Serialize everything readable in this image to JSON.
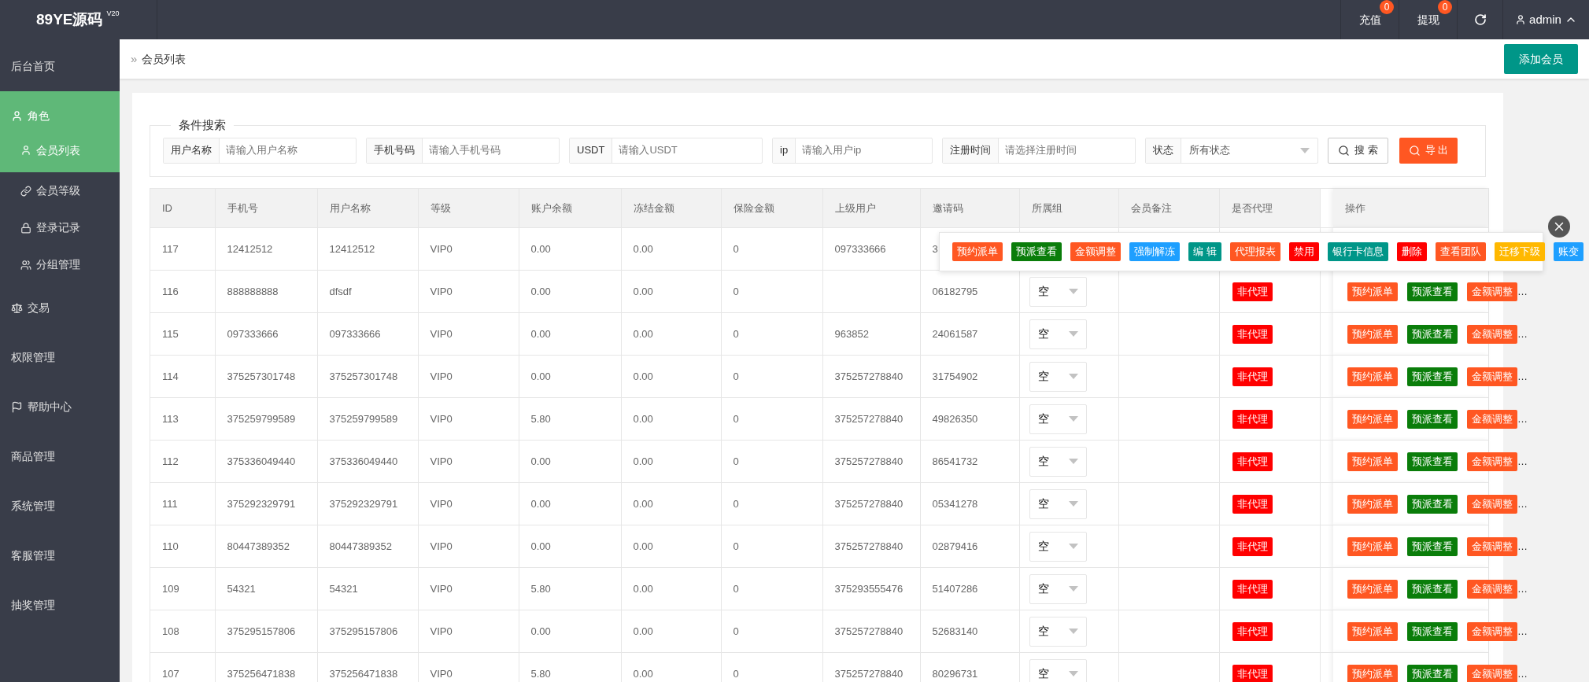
{
  "topbar": {
    "logo": "89YE源码",
    "version": "V20",
    "nav": [
      {
        "label": "充值",
        "badge": "0"
      },
      {
        "label": "提现",
        "badge": "0"
      }
    ],
    "user": "admin"
  },
  "sidebar": {
    "items": [
      {
        "label": "后台首页",
        "selected": false
      },
      {
        "label": "角色",
        "selected": true,
        "expanded": true,
        "children": [
          {
            "label": "会员列表",
            "selected": true
          },
          {
            "label": "会员等级",
            "selected": false
          },
          {
            "label": "登录记录",
            "selected": false
          },
          {
            "label": "分组管理",
            "selected": false
          }
        ]
      },
      {
        "label": "交易",
        "selected": false
      },
      {
        "label": "权限管理",
        "selected": false
      },
      {
        "label": "帮助中心",
        "selected": false
      },
      {
        "label": "商品管理",
        "selected": false
      },
      {
        "label": "系统管理",
        "selected": false
      },
      {
        "label": "客服管理",
        "selected": false
      },
      {
        "label": "抽奖管理",
        "selected": false
      }
    ]
  },
  "breadcrumb": {
    "separator": "»",
    "current": "会员列表"
  },
  "add_button": "添加会员",
  "search": {
    "legend": "条件搜索",
    "fields": [
      {
        "kind": "input",
        "label": "用户名称",
        "placeholder": "请输入用户名称"
      },
      {
        "kind": "input",
        "label": "手机号码",
        "placeholder": "请输入手机号码"
      },
      {
        "kind": "input",
        "label": "USDT",
        "placeholder": "请输入USDT"
      },
      {
        "kind": "input",
        "label": "ip",
        "placeholder": "请输入用户ip"
      },
      {
        "kind": "input",
        "label": "注册时间",
        "placeholder": "请选择注册时间"
      },
      {
        "kind": "select",
        "label": "状态",
        "value": "所有状态"
      }
    ],
    "buttons": [
      {
        "kind": "default",
        "label": "搜 索"
      },
      {
        "kind": "danger",
        "label": "导 出"
      }
    ]
  },
  "table": {
    "columns": [
      "ID",
      "手机号",
      "用户名称",
      "等级",
      "账户余额",
      "冻结金额",
      "保险金额",
      "上级用户",
      "邀请码",
      "所属组",
      "会员备注",
      "是否代理",
      "操作"
    ],
    "rows": [
      {
        "cells": [
          "117",
          "12412512",
          "12412512",
          "VIP0",
          "0.00",
          "0.00",
          "0",
          "097333666",
          "3"
        ]
      },
      {
        "cells": [
          "116",
          "888888888",
          "dfsdf",
          "VIP0",
          "0.00",
          "0.00",
          "0",
          "",
          "06182795"
        ],
        "group": "空",
        "agent": "非代理",
        "actions": [
          {
            "label": "预约派单",
            "color": "#ff5722"
          },
          {
            "label": "预派查看",
            "color": "#0a7d0a"
          },
          {
            "label": "金额调整",
            "color": "#ff5722"
          }
        ],
        "more": "…"
      },
      {
        "cells": [
          "115",
          "097333666",
          "097333666",
          "VIP0",
          "0.00",
          "0.00",
          "0",
          "963852",
          "24061587"
        ],
        "group": "空",
        "agent": "非代理",
        "actions": [
          {
            "label": "预约派单",
            "color": "#ff5722"
          },
          {
            "label": "预派查看",
            "color": "#0a7d0a"
          },
          {
            "label": "金额调整",
            "color": "#ff5722"
          }
        ],
        "more": "…"
      },
      {
        "cells": [
          "114",
          "375257301748",
          "375257301748",
          "VIP0",
          "0.00",
          "0.00",
          "0",
          "375257278840",
          "31754902"
        ],
        "group": "空",
        "agent": "非代理",
        "actions": [
          {
            "label": "预约派单",
            "color": "#ff5722"
          },
          {
            "label": "预派查看",
            "color": "#0a7d0a"
          },
          {
            "label": "金额调整",
            "color": "#ff5722"
          }
        ],
        "more": "…"
      },
      {
        "cells": [
          "113",
          "375259799589",
          "375259799589",
          "VIP0",
          "5.80",
          "0.00",
          "0",
          "375257278840",
          "49826350"
        ],
        "group": "空",
        "agent": "非代理",
        "actions": [
          {
            "label": "预约派单",
            "color": "#ff5722"
          },
          {
            "label": "预派查看",
            "color": "#0a7d0a"
          },
          {
            "label": "金额调整",
            "color": "#ff5722"
          }
        ],
        "more": "…"
      },
      {
        "cells": [
          "112",
          "375336049440",
          "375336049440",
          "VIP0",
          "0.00",
          "0.00",
          "0",
          "375257278840",
          "86541732"
        ],
        "group": "空",
        "agent": "非代理",
        "actions": [
          {
            "label": "预约派单",
            "color": "#ff5722"
          },
          {
            "label": "预派查看",
            "color": "#0a7d0a"
          },
          {
            "label": "金额调整",
            "color": "#ff5722"
          }
        ],
        "more": "…"
      },
      {
        "cells": [
          "111",
          "375292329791",
          "375292329791",
          "VIP0",
          "0.00",
          "0.00",
          "0",
          "375257278840",
          "05341278"
        ],
        "group": "空",
        "agent": "非代理",
        "actions": [
          {
            "label": "预约派单",
            "color": "#ff5722"
          },
          {
            "label": "预派查看",
            "color": "#0a7d0a"
          },
          {
            "label": "金额调整",
            "color": "#ff5722"
          }
        ],
        "more": "…"
      },
      {
        "cells": [
          "110",
          "80447389352",
          "80447389352",
          "VIP0",
          "0.00",
          "0.00",
          "0",
          "375257278840",
          "02879416"
        ],
        "group": "空",
        "agent": "非代理",
        "actions": [
          {
            "label": "预约派单",
            "color": "#ff5722"
          },
          {
            "label": "预派查看",
            "color": "#0a7d0a"
          },
          {
            "label": "金额调整",
            "color": "#ff5722"
          }
        ],
        "more": "…"
      },
      {
        "cells": [
          "109",
          "54321",
          "54321",
          "VIP0",
          "5.80",
          "0.00",
          "0",
          "375293555476",
          "51407286"
        ],
        "group": "空",
        "agent": "非代理",
        "actions": [
          {
            "label": "预约派单",
            "color": "#ff5722"
          },
          {
            "label": "预派查看",
            "color": "#0a7d0a"
          },
          {
            "label": "金额调整",
            "color": "#ff5722"
          }
        ],
        "more": "…"
      },
      {
        "cells": [
          "108",
          "375295157806",
          "375295157806",
          "VIP0",
          "0.00",
          "0.00",
          "0",
          "375257278840",
          "52683140"
        ],
        "group": "空",
        "agent": "非代理",
        "actions": [
          {
            "label": "预约派单",
            "color": "#ff5722"
          },
          {
            "label": "预派查看",
            "color": "#0a7d0a"
          },
          {
            "label": "金额调整",
            "color": "#ff5722"
          }
        ],
        "more": "…"
      },
      {
        "cells": [
          "107",
          "375256471838",
          "375256471838",
          "VIP0",
          "5.80",
          "0.00",
          "0",
          "375257278840",
          "80296731"
        ],
        "group": "空",
        "agent": "非代理",
        "actions": [
          {
            "label": "预约派单",
            "color": "#ff5722"
          },
          {
            "label": "预派查看",
            "color": "#0a7d0a"
          },
          {
            "label": "金额调整",
            "color": "#ff5722"
          }
        ],
        "more": "…"
      }
    ]
  },
  "popup": {
    "actions": [
      {
        "label": "预约派单",
        "color": "#ff5722"
      },
      {
        "label": "预派查看",
        "color": "#0a7d0a"
      },
      {
        "label": "金额调整",
        "color": "#ff5722"
      },
      {
        "label": "强制解冻",
        "color": "#1e9fff"
      },
      {
        "label": "编 辑",
        "color": "#009688"
      },
      {
        "label": "代理报表",
        "color": "#ff5722"
      },
      {
        "label": "禁用",
        "color": "#ff0000"
      },
      {
        "label": "银行卡信息",
        "color": "#009688"
      },
      {
        "label": "删除",
        "color": "#ff0000"
      },
      {
        "label": "查看团队",
        "color": "#ff5722"
      },
      {
        "label": "迁移下级",
        "color": "#ffb800"
      },
      {
        "label": "账变",
        "color": "#1e9fff"
      }
    ]
  }
}
